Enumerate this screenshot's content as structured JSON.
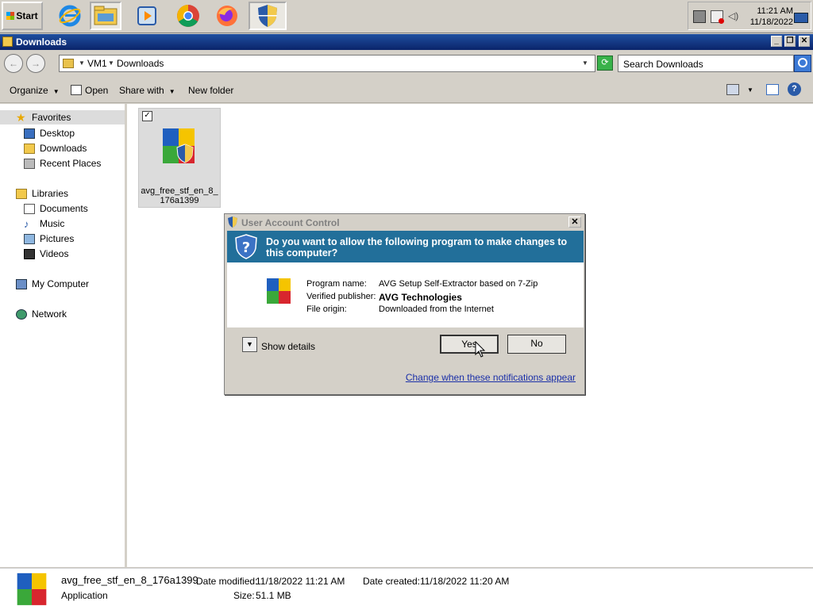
{
  "taskbar": {
    "start_label": "Start",
    "apps": [
      "internet-explorer",
      "file-explorer",
      "media-player",
      "chrome",
      "firefox",
      "uac-shield"
    ],
    "clock_time": "11:21 AM",
    "clock_date": "11/18/2022"
  },
  "window": {
    "title": "Downloads",
    "address": {
      "crumb1": "VM1",
      "crumb2": "Downloads"
    },
    "search_placeholder": "Search Downloads"
  },
  "toolbar": {
    "organize": "Organize",
    "open": "Open",
    "share_with": "Share with",
    "new_folder": "New folder"
  },
  "nav": {
    "favorites": "Favorites",
    "desktop": "Desktop",
    "downloads": "Downloads",
    "recent_places": "Recent Places",
    "libraries": "Libraries",
    "documents": "Documents",
    "music": "Music",
    "pictures": "Pictures",
    "videos": "Videos",
    "my_computer": "My Computer",
    "network": "Network"
  },
  "file": {
    "name": "avg_free_stf_en_8_176a1399"
  },
  "status": {
    "name": "avg_free_stf_en_8_176a1399",
    "type": "Application",
    "date_modified_label": "Date modified:",
    "date_modified": "11/18/2022 11:21 AM",
    "date_created_label": "Date created:",
    "date_created": "11/18/2022 11:20 AM",
    "size_label": "Size:",
    "size": "51.1 MB"
  },
  "uac": {
    "title": "User Account Control",
    "question": "Do you want to allow the following program to make changes to this computer?",
    "program_name_label": "Program name:",
    "program_name": "AVG Setup Self-Extractor based on 7-Zip",
    "publisher_label": "Verified publisher:",
    "publisher": "AVG Technologies",
    "origin_label": "File origin:",
    "origin": "Downloaded from the Internet",
    "show_details": "Show details",
    "yes": "Yes",
    "no": "No",
    "change_link": "Change when these notifications appear"
  }
}
